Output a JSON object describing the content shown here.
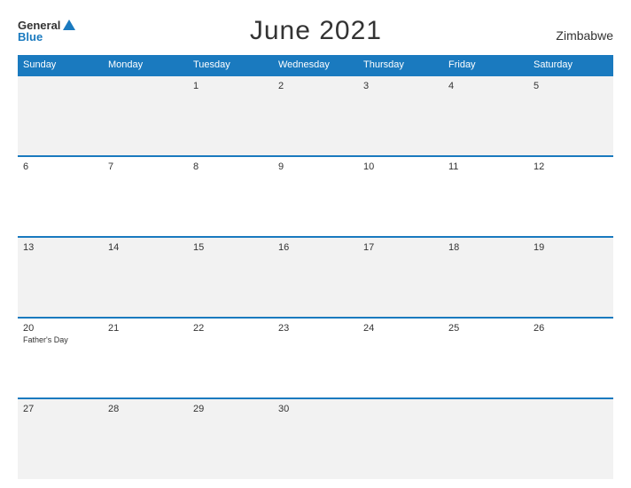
{
  "header": {
    "logo_general": "General",
    "logo_blue": "Blue",
    "title": "June 2021",
    "country": "Zimbabwe"
  },
  "weekdays": [
    "Sunday",
    "Monday",
    "Tuesday",
    "Wednesday",
    "Thursday",
    "Friday",
    "Saturday"
  ],
  "weeks": [
    [
      {
        "day": "",
        "holiday": ""
      },
      {
        "day": "",
        "holiday": ""
      },
      {
        "day": "1",
        "holiday": ""
      },
      {
        "day": "2",
        "holiday": ""
      },
      {
        "day": "3",
        "holiday": ""
      },
      {
        "day": "4",
        "holiday": ""
      },
      {
        "day": "5",
        "holiday": ""
      }
    ],
    [
      {
        "day": "6",
        "holiday": ""
      },
      {
        "day": "7",
        "holiday": ""
      },
      {
        "day": "8",
        "holiday": ""
      },
      {
        "day": "9",
        "holiday": ""
      },
      {
        "day": "10",
        "holiday": ""
      },
      {
        "day": "11",
        "holiday": ""
      },
      {
        "day": "12",
        "holiday": ""
      }
    ],
    [
      {
        "day": "13",
        "holiday": ""
      },
      {
        "day": "14",
        "holiday": ""
      },
      {
        "day": "15",
        "holiday": ""
      },
      {
        "day": "16",
        "holiday": ""
      },
      {
        "day": "17",
        "holiday": ""
      },
      {
        "day": "18",
        "holiday": ""
      },
      {
        "day": "19",
        "holiday": ""
      }
    ],
    [
      {
        "day": "20",
        "holiday": "Father's Day"
      },
      {
        "day": "21",
        "holiday": ""
      },
      {
        "day": "22",
        "holiday": ""
      },
      {
        "day": "23",
        "holiday": ""
      },
      {
        "day": "24",
        "holiday": ""
      },
      {
        "day": "25",
        "holiday": ""
      },
      {
        "day": "26",
        "holiday": ""
      }
    ],
    [
      {
        "day": "27",
        "holiday": ""
      },
      {
        "day": "28",
        "holiday": ""
      },
      {
        "day": "29",
        "holiday": ""
      },
      {
        "day": "30",
        "holiday": ""
      },
      {
        "day": "",
        "holiday": ""
      },
      {
        "day": "",
        "holiday": ""
      },
      {
        "day": "",
        "holiday": ""
      }
    ]
  ]
}
